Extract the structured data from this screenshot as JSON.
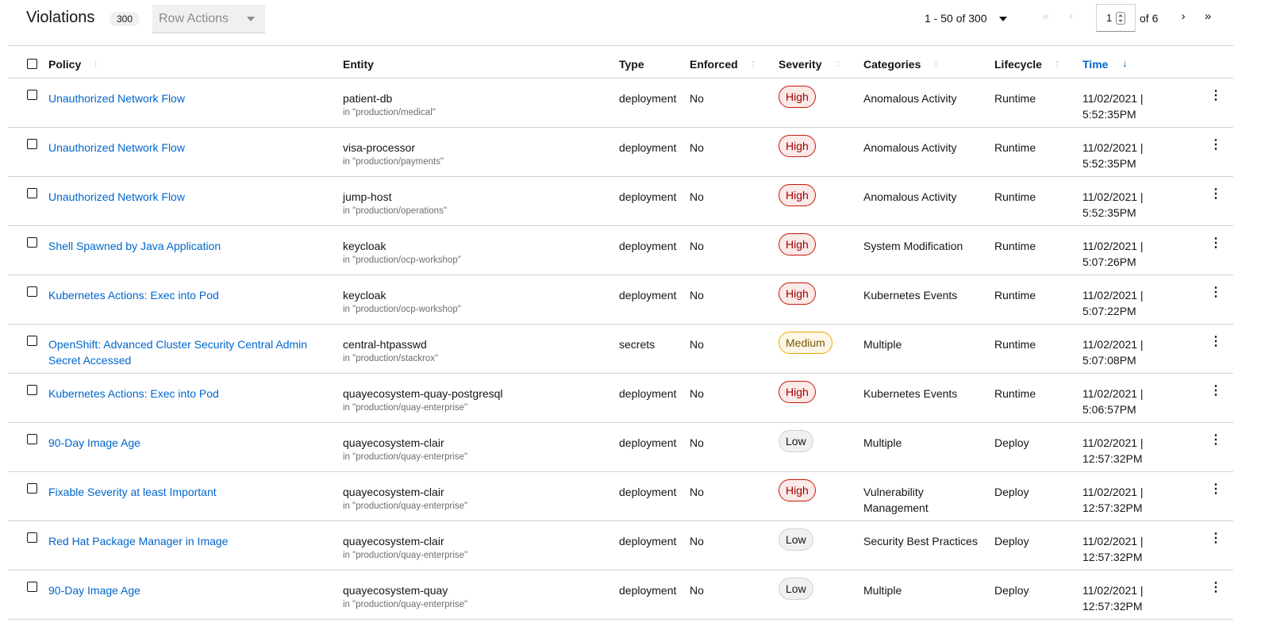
{
  "header": {
    "title": "Violations",
    "count": "300",
    "row_actions_label": "Row Actions"
  },
  "pagination": {
    "range": "1 - 50 of 300",
    "current_page": "1",
    "of_pages": "of 6",
    "first_icon": "angle-double-left-icon",
    "prev_icon": "angle-left-icon",
    "next_icon": "angle-right-icon",
    "last_icon": "angle-double-right-icon"
  },
  "columns": {
    "policy": "Policy",
    "entity": "Entity",
    "type": "Type",
    "enforced": "Enforced",
    "severity": "Severity",
    "categories": "Categories",
    "lifecycle": "Lifecycle",
    "time": "Time"
  },
  "sort": {
    "active_column": "time",
    "direction": "descending"
  },
  "colors": {
    "link": "#0066cc",
    "high": "#c9190b",
    "medium": "#f0ab00",
    "low": "#d2d2d2"
  },
  "rows": [
    {
      "policy": "Unauthorized Network Flow",
      "entity": "patient-db",
      "namespace": "in \"production/medical\"",
      "type": "deployment",
      "enforced": "No",
      "severity": "High",
      "severity_level": "high",
      "categories": "Anomalous Activity",
      "lifecycle": "Runtime",
      "time": "11/02/2021 | 5:52:35PM"
    },
    {
      "policy": "Unauthorized Network Flow",
      "entity": "visa-processor",
      "namespace": "in \"production/payments\"",
      "type": "deployment",
      "enforced": "No",
      "severity": "High",
      "severity_level": "high",
      "categories": "Anomalous Activity",
      "lifecycle": "Runtime",
      "time": "11/02/2021 | 5:52:35PM"
    },
    {
      "policy": "Unauthorized Network Flow",
      "entity": "jump-host",
      "namespace": "in \"production/operations\"",
      "type": "deployment",
      "enforced": "No",
      "severity": "High",
      "severity_level": "high",
      "categories": "Anomalous Activity",
      "lifecycle": "Runtime",
      "time": "11/02/2021 | 5:52:35PM"
    },
    {
      "policy": "Shell Spawned by Java Application",
      "entity": "keycloak",
      "namespace": "in \"production/ocp-workshop\"",
      "type": "deployment",
      "enforced": "No",
      "severity": "High",
      "severity_level": "high",
      "categories": "System Modification",
      "lifecycle": "Runtime",
      "time": "11/02/2021 | 5:07:26PM"
    },
    {
      "policy": "Kubernetes Actions: Exec into Pod",
      "entity": "keycloak",
      "namespace": "in \"production/ocp-workshop\"",
      "type": "deployment",
      "enforced": "No",
      "severity": "High",
      "severity_level": "high",
      "categories": "Kubernetes Events",
      "lifecycle": "Runtime",
      "time": "11/02/2021 | 5:07:22PM"
    },
    {
      "policy": "OpenShift: Advanced Cluster Security Central Admin Secret Accessed",
      "entity": "central-htpasswd",
      "namespace": "in \"production/stackrox\"",
      "type": "secrets",
      "enforced": "No",
      "severity": "Medium",
      "severity_level": "medium",
      "categories": "Multiple",
      "lifecycle": "Runtime",
      "time": "11/02/2021 | 5:07:08PM"
    },
    {
      "policy": "Kubernetes Actions: Exec into Pod",
      "entity": "quayecosystem-quay-postgresql",
      "namespace": "in \"production/quay-enterprise\"",
      "type": "deployment",
      "enforced": "No",
      "severity": "High",
      "severity_level": "high",
      "categories": "Kubernetes Events",
      "lifecycle": "Runtime",
      "time": "11/02/2021 | 5:06:57PM"
    },
    {
      "policy": "90-Day Image Age",
      "entity": "quayecosystem-clair",
      "namespace": "in \"production/quay-enterprise\"",
      "type": "deployment",
      "enforced": "No",
      "severity": "Low",
      "severity_level": "low",
      "categories": "Multiple",
      "lifecycle": "Deploy",
      "time": "11/02/2021 | 12:57:32PM"
    },
    {
      "policy": "Fixable Severity at least Important",
      "entity": "quayecosystem-clair",
      "namespace": "in \"production/quay-enterprise\"",
      "type": "deployment",
      "enforced": "No",
      "severity": "High",
      "severity_level": "high",
      "categories": "Vulnerability Management",
      "lifecycle": "Deploy",
      "time": "11/02/2021 | 12:57:32PM"
    },
    {
      "policy": "Red Hat Package Manager in Image",
      "entity": "quayecosystem-clair",
      "namespace": "in \"production/quay-enterprise\"",
      "type": "deployment",
      "enforced": "No",
      "severity": "Low",
      "severity_level": "low",
      "categories": "Security Best Practices",
      "lifecycle": "Deploy",
      "time": "11/02/2021 | 12:57:32PM"
    },
    {
      "policy": "90-Day Image Age",
      "entity": "quayecosystem-quay",
      "namespace": "in \"production/quay-enterprise\"",
      "type": "deployment",
      "enforced": "No",
      "severity": "Low",
      "severity_level": "low",
      "categories": "Multiple",
      "lifecycle": "Deploy",
      "time": "11/02/2021 | 12:57:32PM"
    }
  ]
}
